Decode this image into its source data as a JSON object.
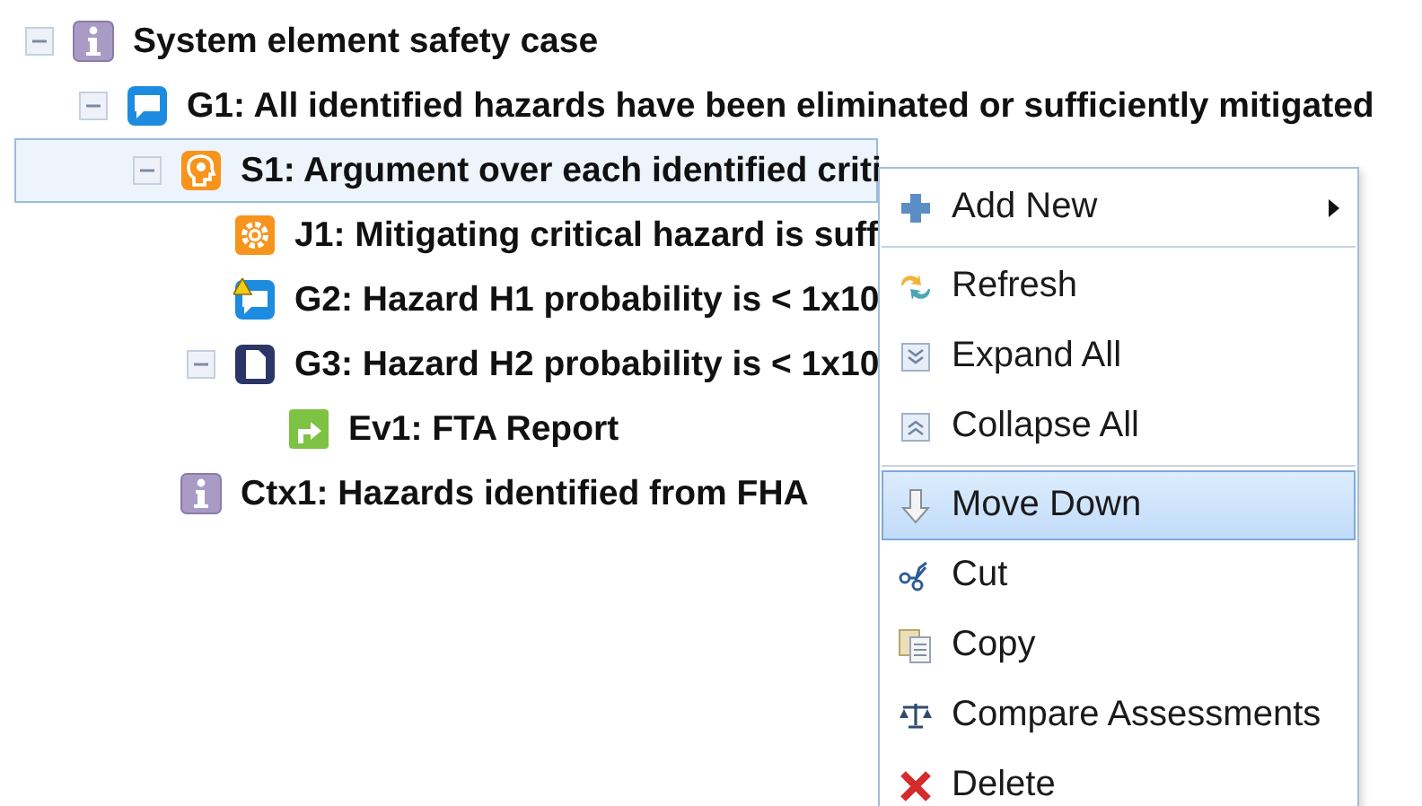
{
  "tree": [
    {
      "label": "System element safety case",
      "kind": "info",
      "expanded": true,
      "selected": false,
      "children": [
        {
          "label": "G1: All identified hazards have been eliminated or sufficiently mitigated",
          "kind": "goal",
          "expanded": true,
          "selected": false,
          "children": [
            {
              "label": "S1: Argument over each identified criti",
              "kind": "strategy",
              "expanded": true,
              "selected": true,
              "children": [
                {
                  "label": "J1: Mitigating critical hazard is suff",
                  "kind": "justification",
                  "selected": false
                },
                {
                  "label": "G2: Hazard H1 probability is < 1x10",
                  "kind": "goal-warning",
                  "selected": false
                },
                {
                  "label": "G3: Hazard H2 probability is < 1x10",
                  "kind": "document",
                  "expanded": true,
                  "selected": false,
                  "children": [
                    {
                      "label": "Ev1: FTA Report",
                      "kind": "evidence",
                      "selected": false
                    }
                  ]
                }
              ]
            },
            {
              "label": "Ctx1: Hazards identified from FHA",
              "kind": "info",
              "selected": false
            }
          ]
        }
      ]
    }
  ],
  "context_menu": [
    {
      "label": "Add New",
      "kind": "plus",
      "submenu": true,
      "selected": false,
      "separator_after": true
    },
    {
      "label": "Refresh",
      "kind": "refresh",
      "selected": false
    },
    {
      "label": "Expand All",
      "kind": "expand",
      "selected": false
    },
    {
      "label": "Collapse All",
      "kind": "collapse",
      "selected": false,
      "separator_after": true
    },
    {
      "label": "Move Down",
      "kind": "down",
      "selected": true
    },
    {
      "label": "Cut",
      "kind": "cut",
      "selected": false
    },
    {
      "label": "Copy",
      "kind": "copy",
      "selected": false
    },
    {
      "label": "Compare Assessments",
      "kind": "scales",
      "selected": false
    },
    {
      "label": "Delete",
      "kind": "delete",
      "selected": false
    }
  ]
}
